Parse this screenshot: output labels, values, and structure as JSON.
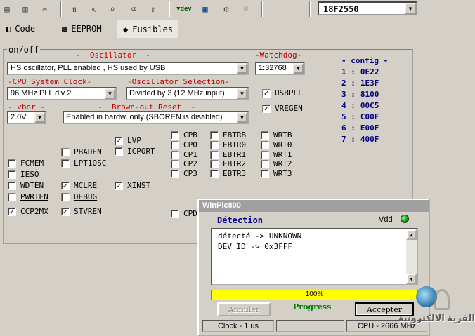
{
  "device": "18F2550",
  "tabs": [
    {
      "label": "Code"
    },
    {
      "label": "EEPROM"
    },
    {
      "label": "Fusibles"
    }
  ],
  "panel_title": "on/off",
  "labels": {
    "oscillator": "-  Oscillator  -",
    "watchdog": "-Watchdog-",
    "cpu_clock": "-CPU System Clock-",
    "osc_selection": "-Oscillator Selection-",
    "vbor": "- vbor -",
    "brownout": "-  Brown-out Reset  -"
  },
  "combos": {
    "oscillator": "HS oscillator, PLL enabled , HS used by USB",
    "watchdog": "1:32768",
    "cpu_clock": "96 MHz PLL div 2",
    "osc_selection": "Divided by 3 (12 MHz input)",
    "vbor": "2.0V",
    "brownout": "Enabled in hardw. only (SBOREN is disabled)"
  },
  "config": {
    "title": "- config -",
    "entries": [
      {
        "num": "1 :",
        "val": "0E22"
      },
      {
        "num": "2 :",
        "val": "1E3F"
      },
      {
        "num": "3 :",
        "val": "8100"
      },
      {
        "num": "4 :",
        "val": "00C5"
      },
      {
        "num": "5 :",
        "val": "C00F"
      },
      {
        "num": "6 :",
        "val": "E00F"
      },
      {
        "num": "7 :",
        "val": "400F"
      }
    ]
  },
  "checkboxes": {
    "usbpll": {
      "label": "USBPLL",
      "checked": true
    },
    "vregen": {
      "label": "VREGEN",
      "checked": true
    },
    "lvp": {
      "label": "LVP",
      "checked": true
    },
    "icport": {
      "label": "ICPORT",
      "checked": false
    },
    "pbaden": {
      "label": "PBADEN",
      "checked": false
    },
    "lpt1osc": {
      "label": "LPT1OSC",
      "checked": false
    },
    "fcmem": {
      "label": "FCMEM",
      "checked": false
    },
    "ieso": {
      "label": "IESO",
      "checked": false
    },
    "wdten": {
      "label": "WDTEN",
      "checked": false
    },
    "mclre": {
      "label": "MCLRE",
      "checked": true
    },
    "xinst": {
      "label": "XINST",
      "checked": true
    },
    "pwrten": {
      "label": "PWRTEN",
      "checked": false
    },
    "debug": {
      "label": "DEBUG",
      "checked": false
    },
    "ccp2mx": {
      "label": "CCP2MX",
      "checked": true
    },
    "stvren": {
      "label": "STVREN",
      "checked": true
    },
    "cpb": {
      "label": "CPB",
      "checked": false
    },
    "cp0": {
      "label": "CP0",
      "checked": false
    },
    "cp1": {
      "label": "CP1",
      "checked": false
    },
    "cp2": {
      "label": "CP2",
      "checked": false
    },
    "cp3": {
      "label": "CP3",
      "checked": false
    },
    "ebtrb": {
      "label": "EBTRB",
      "checked": false
    },
    "ebtr0": {
      "label": "EBTR0",
      "checked": false
    },
    "ebtr1": {
      "label": "EBTR1",
      "checked": false
    },
    "ebtr2": {
      "label": "EBTR2",
      "checked": false
    },
    "ebtr3": {
      "label": "EBTR3",
      "checked": false
    },
    "wrtb": {
      "label": "WRTB",
      "checked": false
    },
    "wrt0": {
      "label": "WRT0",
      "checked": false
    },
    "wrt1": {
      "label": "WRT1",
      "checked": false
    },
    "wrt2": {
      "label": "WRT2",
      "checked": false
    },
    "wrt3": {
      "label": "WRT3",
      "checked": false
    },
    "cpd": {
      "label": "CPD",
      "checked": false
    }
  },
  "dialog": {
    "title": "WinPic800",
    "heading": "Détection",
    "vdd_label": "Vdd",
    "log": [
      "détecté -> UNKNOWN",
      "DEV ID  -> 0x3FFF"
    ],
    "progress_text": "100%",
    "progress_value": 100,
    "progress_label": "Progress",
    "cancel_label": "Annuler",
    "accept_label": "Accepter",
    "status_clock": "Clock - 1 us",
    "status_middle": "",
    "status_cpu": "CPU - 2666 MHz"
  },
  "watermark_text": "القرية الالكترونية",
  "colors": {
    "bg": "#d4d0c8",
    "label_red": "#c00000",
    "label_blue": "#000080",
    "progress": "#ffff00",
    "led": "#00a000"
  }
}
